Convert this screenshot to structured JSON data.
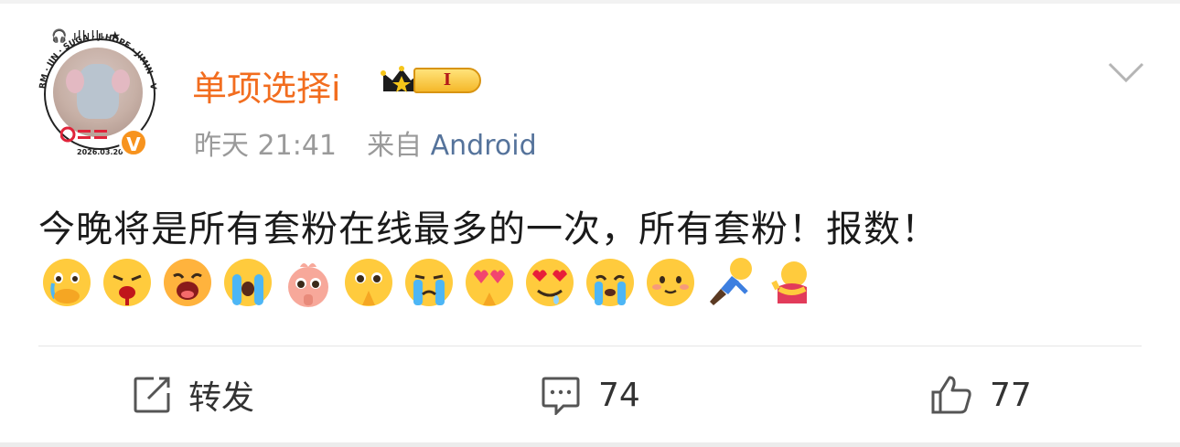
{
  "post": {
    "username": "单项选择i",
    "vip_level": "I",
    "time": "昨天 21:41",
    "source_prefix": "来自",
    "source": "Android",
    "text": "今晚将是所有套粉在线最多的一次，所有套粉！报数！",
    "emojis": [
      "covering-mouth-crying",
      "bleeding-face",
      "yawning-face",
      "tears-streaming",
      "pink-creature-pleading",
      "pleading-hands",
      "loudly-crying",
      "heart-eyes-hands",
      "heart-eyes-drool",
      "crying-face",
      "shy-smile",
      "fallen-person",
      "hugging-person"
    ]
  },
  "avatar": {
    "badge": "V",
    "ring_text": "RM · JIN · SUGA · J-HOPE · JIMIN · V · JUNGKOOK",
    "date": "2026.03.20",
    "top_icons": "🎧 ıllıllı ★"
  },
  "actions": {
    "repost_label": "转发",
    "comment_count": "74",
    "like_count": "77"
  },
  "colors": {
    "username": "#f26d1f",
    "meta": "#9a9a9a",
    "source": "#55739b",
    "badge": "#f7931e"
  }
}
